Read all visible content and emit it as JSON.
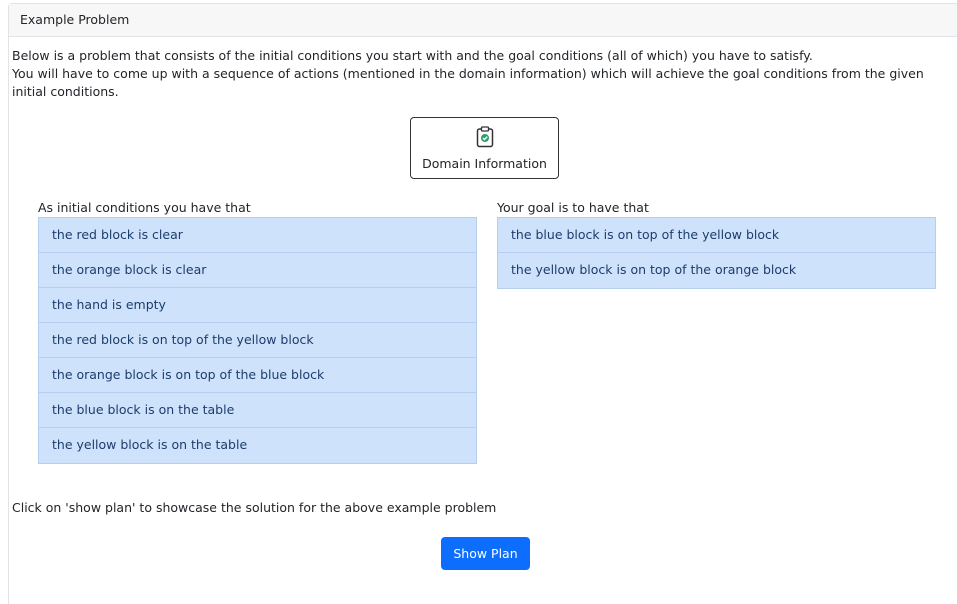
{
  "header": {
    "title": "Example Problem"
  },
  "description": {
    "line1": "Below is a problem that consists of the initial conditions you start with and the goal conditions (all of which) you have to satisfy.",
    "line2": "You will have to come up with a sequence of actions (mentioned in the domain information) which will achieve the goal conditions from the given initial conditions."
  },
  "domain_button": {
    "label": "Domain Information",
    "icon": "clipboard-check-icon",
    "icon_color": "#2f9e6b"
  },
  "initial": {
    "title": "As initial conditions you have that",
    "items": [
      "the red block is clear",
      "the orange block is clear",
      "the hand is empty",
      "the red block is on top of the yellow block",
      "the orange block is on top of the blue block",
      "the blue block is on the table",
      "the yellow block is on the table"
    ]
  },
  "goal": {
    "title": "Your goal is to have that",
    "items": [
      "the blue block is on top of the yellow block",
      "the yellow block is on top of the orange block"
    ]
  },
  "hint": "Click on 'show plan' to showcase the solution for the above example problem",
  "show_plan_button": {
    "label": "Show Plan",
    "color": "#0d6efd"
  },
  "colors": {
    "list_bg": "#cfe2fc",
    "list_text": "#1c3d6b",
    "list_border": "#b6cff0"
  }
}
